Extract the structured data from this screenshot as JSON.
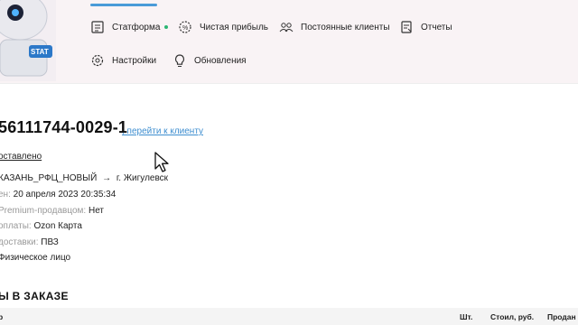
{
  "nav": {
    "items": [
      {
        "label": "Статформа",
        "icon": "form-icon",
        "active": true
      },
      {
        "label": "Чистая прибыль",
        "icon": "percent-gear-icon"
      },
      {
        "label": "Постоянные клиенты",
        "icon": "users-icon"
      },
      {
        "label": "Отчеты",
        "icon": "report-icon"
      },
      {
        "label": "Настройки",
        "icon": "gear-icon"
      },
      {
        "label": "Обновления",
        "icon": "bulb-icon"
      }
    ],
    "logo_text": "STAT"
  },
  "order": {
    "id": "56111744-0029-1",
    "client_link": ", перейти к клиенту",
    "status": "оставлено",
    "route_from": "КАЗАНЬ_РФЦ_НОВЫЙ",
    "route_arrow": "→",
    "route_to": "г. Жигулевск",
    "created_label": "ен:",
    "created_value": "20 апреля 2023 20:35:34",
    "premium_label": "Premium-продавцом:",
    "premium_value": "Нет",
    "payment_label": "оплаты:",
    "payment_value": "Ozon Карта",
    "delivery_label": "доставки:",
    "delivery_value": "ПВЗ",
    "buyer_type": "Физическое лицо"
  },
  "items_section": {
    "title": "Ы В ЗАКАЗЕ",
    "columns": [
      "р",
      "Шт.",
      "Стоил, руб.",
      "Продан з"
    ]
  },
  "colors": {
    "header_bg": "#f9f3f5",
    "accent": "#4a9bd8",
    "link": "#3e8ed0",
    "active_dot": "#2bb673"
  }
}
